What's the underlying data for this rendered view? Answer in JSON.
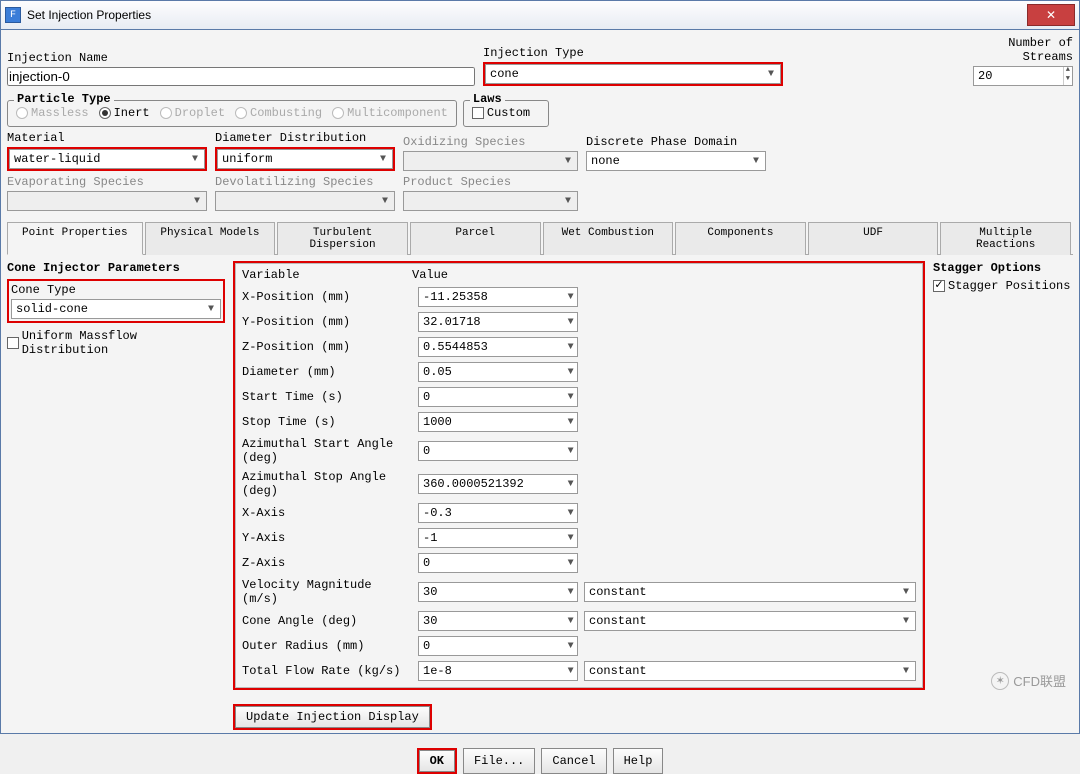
{
  "window": {
    "title": "Set Injection Properties",
    "close": "✕"
  },
  "top": {
    "injection_name_label": "Injection Name",
    "injection_name": "injection-0",
    "injection_type_label": "Injection Type",
    "injection_type": "cone",
    "num_streams_label": "Number of Streams",
    "num_streams": "20"
  },
  "particle": {
    "legend": "Particle Type",
    "massless": "Massless",
    "inert": "Inert",
    "droplet": "Droplet",
    "combusting": "Combusting",
    "multicomponent": "Multicomponent"
  },
  "laws": {
    "legend": "Laws",
    "custom": "Custom"
  },
  "mid": {
    "material_label": "Material",
    "material": "water-liquid",
    "diam_dist_label": "Diameter Distribution",
    "diam_dist": "uniform",
    "oxid_label": "Oxidizing Species",
    "discrete_label": "Discrete Phase Domain",
    "discrete": "none",
    "evap_label": "Evaporating Species",
    "devol_label": "Devolatilizing Species",
    "prod_label": "Product Species"
  },
  "tabs": {
    "point": "Point Properties",
    "physical": "Physical Models",
    "turb": "Turbulent Dispersion",
    "parcel": "Parcel",
    "wet": "Wet Combustion",
    "comp": "Components",
    "udf": "UDF",
    "mult": "Multiple Reactions"
  },
  "cone": {
    "heading": "Cone Injector Parameters",
    "type_label": "Cone Type",
    "type": "solid-cone",
    "uniform_massflow": "Uniform Massflow Distribution"
  },
  "vars": {
    "var_h": "Variable",
    "val_h": "Value",
    "rows": [
      {
        "name": "X-Position (mm)",
        "value": "-11.25358",
        "extra": null
      },
      {
        "name": "Y-Position (mm)",
        "value": "32.01718",
        "extra": null
      },
      {
        "name": "Z-Position (mm)",
        "value": "0.5544853",
        "extra": null
      },
      {
        "name": "Diameter (mm)",
        "value": "0.05",
        "extra": null
      },
      {
        "name": "Start Time (s)",
        "value": "0",
        "extra": null
      },
      {
        "name": "Stop Time (s)",
        "value": "1000",
        "extra": null
      },
      {
        "name": "Azimuthal Start Angle (deg)",
        "value": "0",
        "extra": null
      },
      {
        "name": "Azimuthal Stop Angle (deg)",
        "value": "360.0000521392",
        "extra": null
      },
      {
        "name": "X-Axis",
        "value": "-0.3",
        "extra": null
      },
      {
        "name": "Y-Axis",
        "value": "-1",
        "extra": null
      },
      {
        "name": "Z-Axis",
        "value": "0",
        "extra": null
      },
      {
        "name": "Velocity Magnitude (m/s)",
        "value": "30",
        "extra": "constant"
      },
      {
        "name": "Cone Angle (deg)",
        "value": "30",
        "extra": "constant"
      },
      {
        "name": "Outer Radius (mm)",
        "value": "0",
        "extra": null
      },
      {
        "name": "Total Flow Rate (kg/s)",
        "value": "1e-8",
        "extra": "constant"
      }
    ]
  },
  "stagger": {
    "heading": "Stagger Options",
    "positions": "Stagger Positions"
  },
  "buttons": {
    "update": "Update Injection Display",
    "ok": "OK",
    "file": "File...",
    "cancel": "Cancel",
    "help": "Help"
  },
  "watermark": "CFD联盟"
}
